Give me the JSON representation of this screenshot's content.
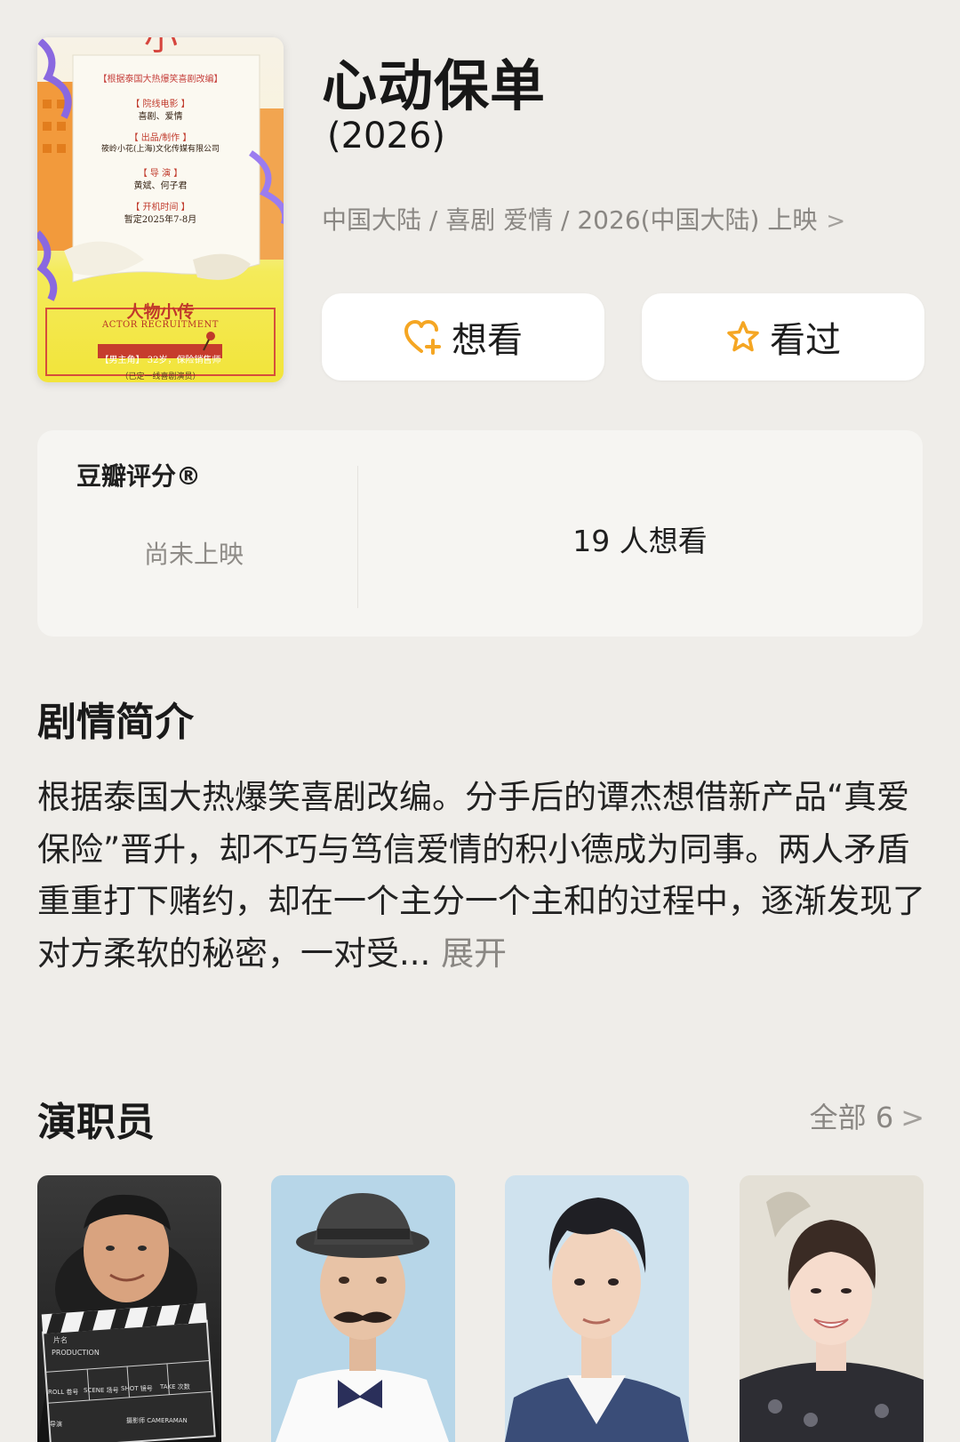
{
  "movie": {
    "title": "心动保单",
    "year": "(2026)",
    "meta": "中国大陆 / 喜剧 爱情 / 2026(中国大陆) 上映",
    "meta_chevron": ">"
  },
  "poster": {
    "lines": [
      "【根据泰国大热爆笑喜剧改编】",
      "【 院线电影 】",
      "喜剧、爱情",
      "【 出品/制作 】",
      "筱岭小花(上海)文化传媒有限公司",
      "【 导 演 】",
      "黄斌、何子君",
      "【 开机时间 】",
      "暂定2025年7-8月"
    ],
    "actor_heading": "人物小传",
    "actor_recruit": "ACTOR RECRUITMENT",
    "role": "【男主角】 32岁，保险销售师",
    "note": "（已定一线喜剧演员）"
  },
  "actions": {
    "want_label": "想看",
    "watched_label": "看过",
    "accent_color": "#f5a623"
  },
  "rating": {
    "title": "豆瓣评分®",
    "status": "尚未上映",
    "want_count": "19 人想看"
  },
  "synopsis": {
    "title": "剧情简介",
    "text": "根据泰国大热爆笑喜剧改编。分手后的谭杰想借新产品“真爱保险”晋升，却不巧与笃信爱情的积小德成为同事。两人矛盾重重打下赌约，却在一个主分一个主和的过程中，逐渐发现了对方柔软的秘密，一对受...",
    "expand_label": "展开"
  },
  "cast": {
    "title": "演职员",
    "all_label": "全部 6",
    "all_chevron": ">",
    "clapper_text": {
      "production": "PRODUCTION",
      "roll": "ROLL 卷号",
      "scene": "SCENE 场号",
      "shot": "SHOT 镜号",
      "take": "TAKE 次数",
      "director": "导演",
      "cameraman": "摄影师 CAMERAMAN",
      "film": "片名"
    },
    "people": [
      {
        "name": "cast-member-1"
      },
      {
        "name": "cast-member-2"
      },
      {
        "name": "cast-member-3"
      },
      {
        "name": "cast-member-4"
      }
    ]
  }
}
